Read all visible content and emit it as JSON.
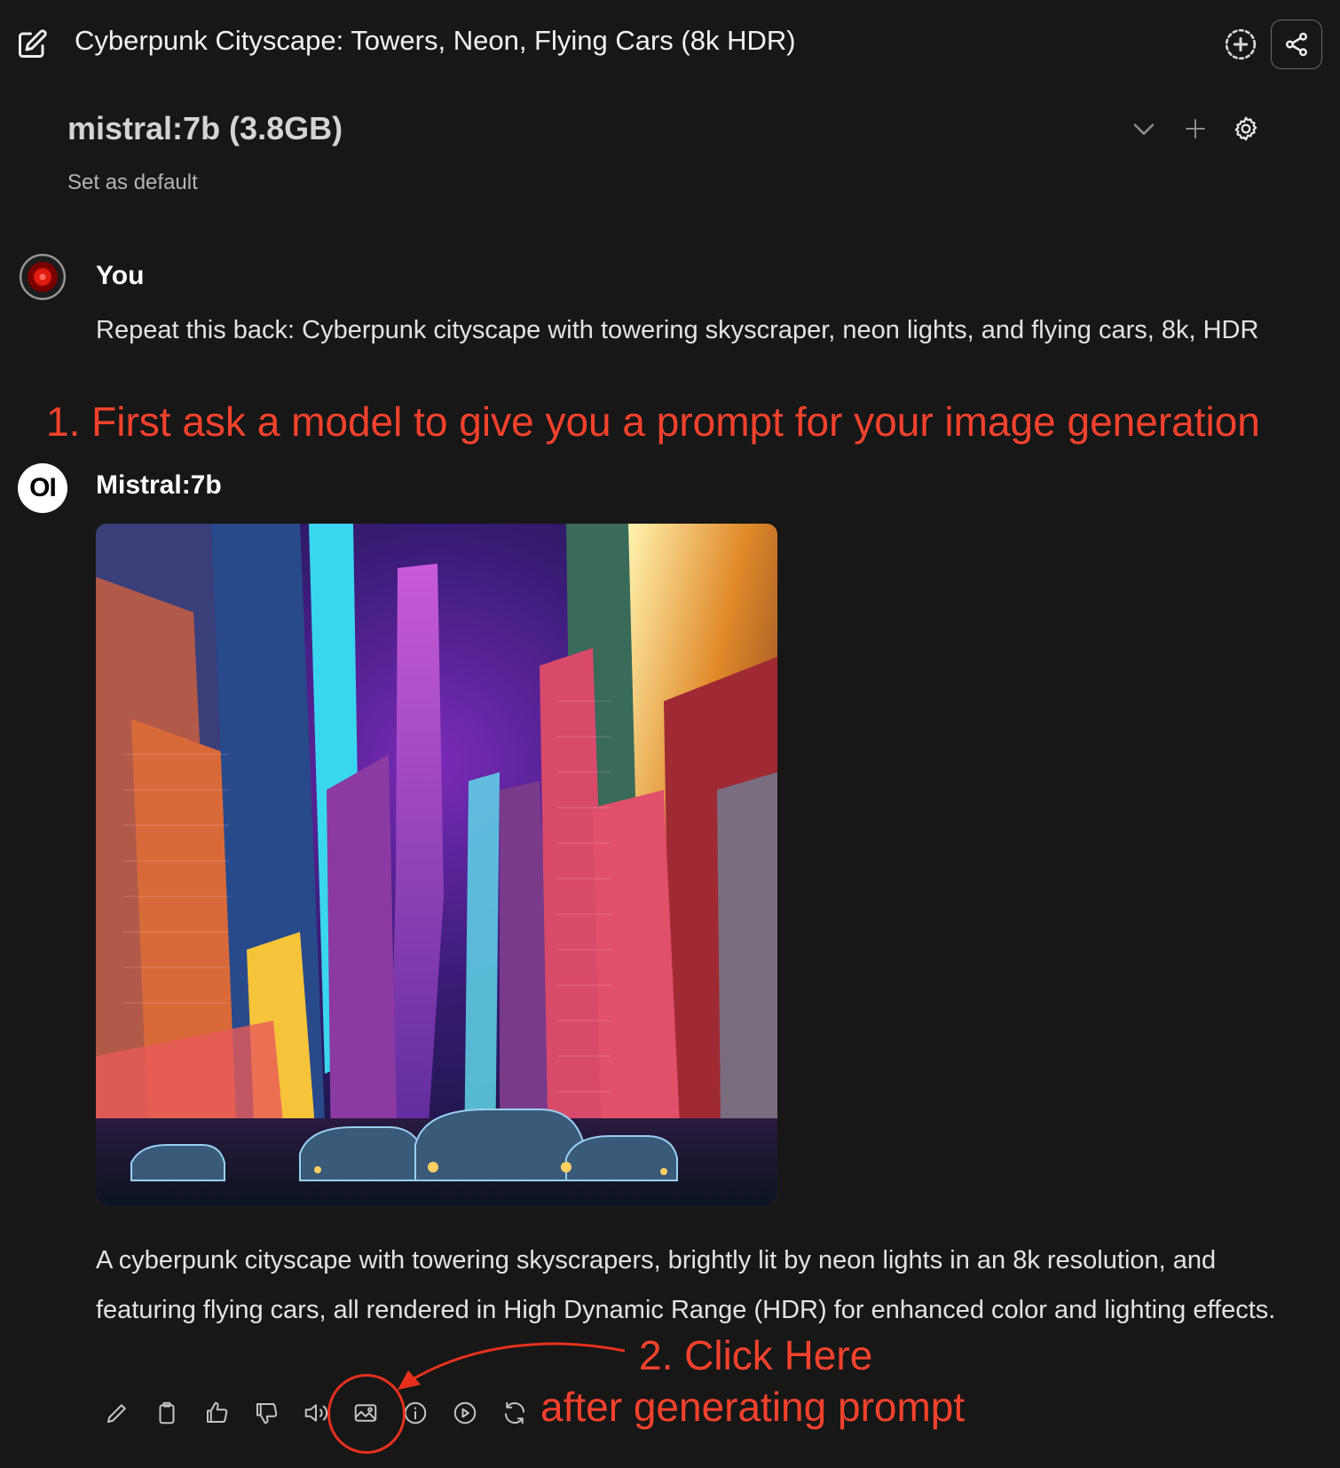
{
  "header": {
    "title": "Cyberpunk Cityscape: Towers, Neon, Flying Cars (8k HDR)",
    "icons": [
      "edit-icon",
      "new-chat-icon",
      "share-icon"
    ]
  },
  "model_selector": {
    "model": "mistral:7b (3.8GB)",
    "set_default": "Set as default",
    "icons": [
      "chevron-down-icon",
      "plus-icon",
      "gear-icon"
    ]
  },
  "messages": [
    {
      "author": "You",
      "text": "Repeat this back: Cyberpunk cityscape with towering skyscraper, neon lights, and flying cars, 8k, HDR"
    },
    {
      "author": "Mistral:7b",
      "avatar_text": "OI",
      "text": "A cyberpunk cityscape with towering skyscrapers, brightly lit by neon lights in an 8k resolution, and featuring flying cars, all rendered in High Dynamic Range (HDR) for enhanced color and lighting effects."
    }
  ],
  "toolbar": {
    "icons": [
      "pencil-icon",
      "clipboard-icon",
      "thumbs-up-icon",
      "thumbs-down-icon",
      "speaker-icon",
      "image-icon",
      "info-icon",
      "play-icon",
      "regenerate-icon"
    ]
  },
  "annotations": {
    "step1": "1. First ask a model to give you a prompt for your image generation",
    "step2_line1": "2. Click Here",
    "step2_line2": "after generating prompt",
    "accent_color": "#f4422c"
  }
}
